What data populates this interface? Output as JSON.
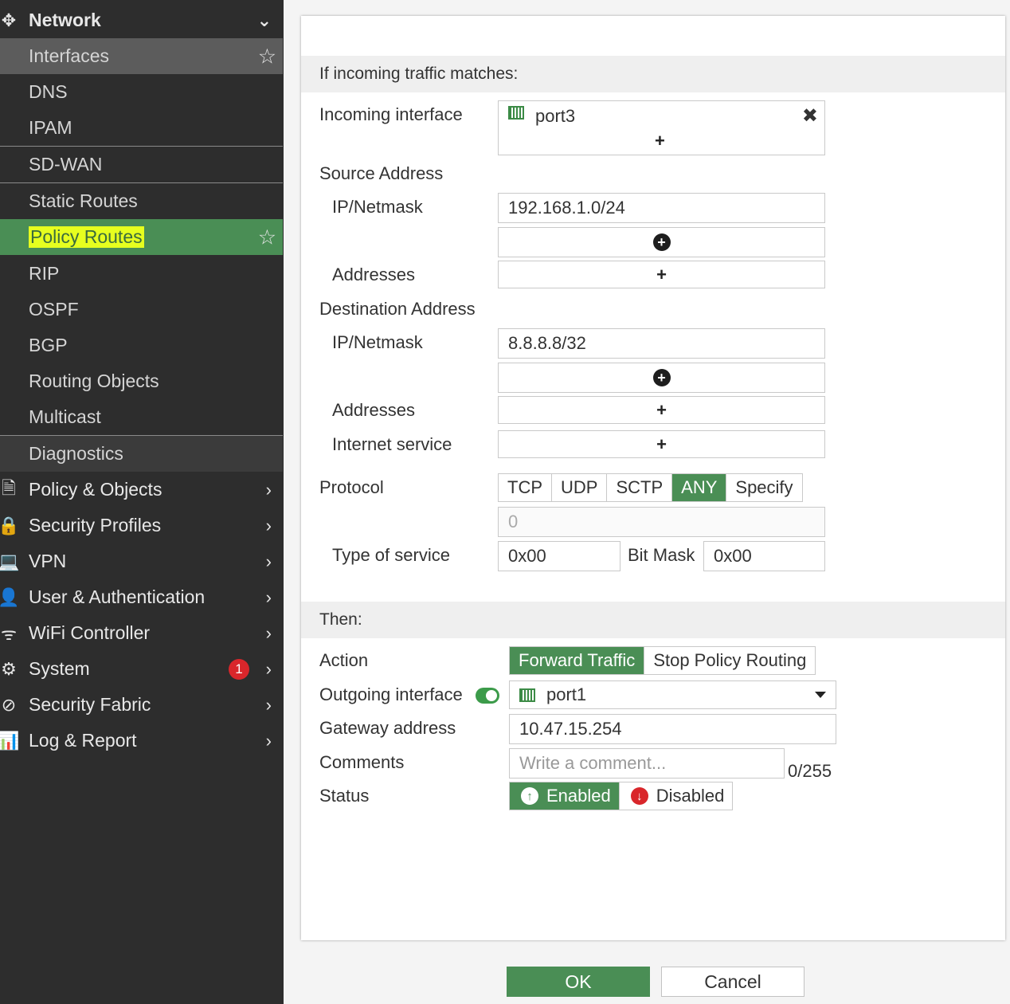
{
  "sidebar": {
    "network": "Network",
    "items": [
      {
        "label": "Interfaces"
      },
      {
        "label": "DNS"
      },
      {
        "label": "IPAM"
      },
      {
        "label": "SD-WAN"
      },
      {
        "label": "Static Routes"
      },
      {
        "label": "Policy Routes"
      },
      {
        "label": "RIP"
      },
      {
        "label": "OSPF"
      },
      {
        "label": "BGP"
      },
      {
        "label": "Routing Objects"
      },
      {
        "label": "Multicast"
      },
      {
        "label": "Diagnostics"
      }
    ],
    "sections": [
      {
        "label": "Policy & Objects"
      },
      {
        "label": "Security Profiles"
      },
      {
        "label": "VPN"
      },
      {
        "label": "User & Authentication"
      },
      {
        "label": "WiFi Controller"
      },
      {
        "label": "System",
        "badge": "1"
      },
      {
        "label": "Security Fabric"
      },
      {
        "label": "Log & Report"
      }
    ]
  },
  "form": {
    "match_header": "If incoming traffic matches:",
    "incoming_interface_label": "Incoming interface",
    "incoming_interface_value": "port3",
    "source_address_label": "Source Address",
    "ip_netmask_label": "IP/Netmask",
    "source_ip": "192.168.1.0/24",
    "addresses_label": "Addresses",
    "destination_address_label": "Destination Address",
    "dest_ip": "8.8.8.8/32",
    "internet_service_label": "Internet service",
    "protocol_label": "Protocol",
    "protocols": [
      "TCP",
      "UDP",
      "SCTP",
      "ANY",
      "Specify"
    ],
    "protocol_selected": "ANY",
    "protocol_number": "0",
    "tos_label": "Type of service",
    "tos_value": "0x00",
    "bitmask_label": "Bit Mask",
    "bitmask_value": "0x00",
    "then_header": "Then:",
    "action_label": "Action",
    "actions": [
      "Forward Traffic",
      "Stop Policy Routing"
    ],
    "action_selected": "Forward Traffic",
    "outgoing_interface_label": "Outgoing interface",
    "outgoing_interface_value": "port1",
    "gateway_label": "Gateway address",
    "gateway_value": "10.47.15.254",
    "comments_label": "Comments",
    "comments_placeholder": "Write a comment...",
    "comments_count": "0/255",
    "status_label": "Status",
    "status_enabled": "Enabled",
    "status_disabled": "Disabled"
  },
  "footer": {
    "ok": "OK",
    "cancel": "Cancel"
  },
  "colors": {
    "accent_green": "#4a8e55",
    "sidebar_bg": "#2d2d2d",
    "highlight": "#e6ff1f",
    "badge_red": "#d9262b"
  }
}
